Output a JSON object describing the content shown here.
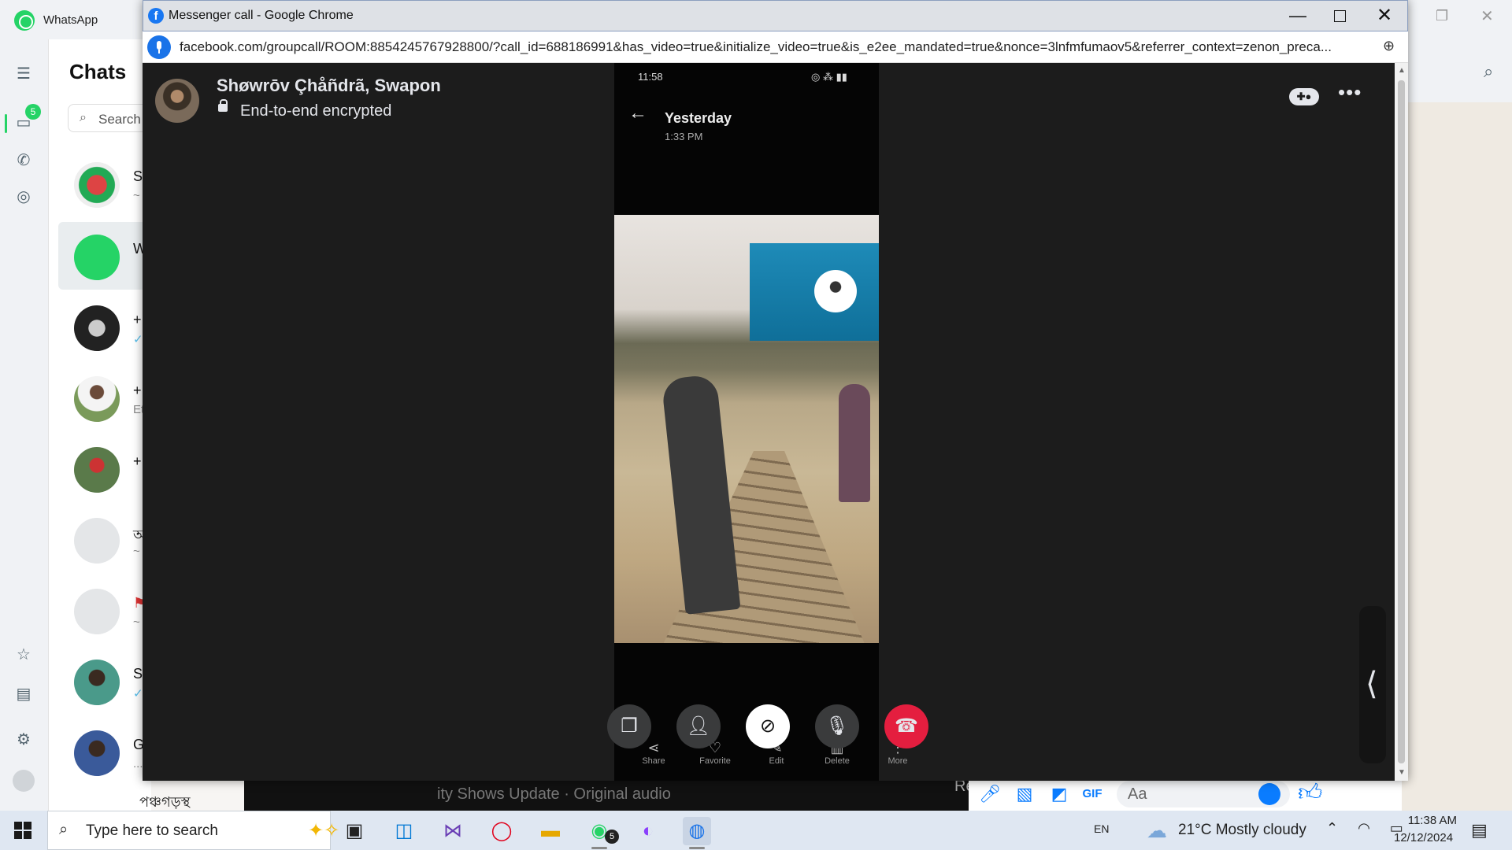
{
  "whatsapp": {
    "title": "WhatsApp",
    "badge": "5",
    "chats_title": "Chats",
    "search_placeholder": "Search",
    "chats": [
      {
        "name": "Sa",
        "sub": "~"
      },
      {
        "name": "W",
        "sub": ""
      },
      {
        "name": "+",
        "sub": "✓"
      },
      {
        "name": "+",
        "sub": "Et"
      },
      {
        "name": "+",
        "sub": ""
      },
      {
        "name": "অ",
        "sub": "~"
      },
      {
        "name": "",
        "sub": "~"
      },
      {
        "name": "Sl",
        "sub": "✓"
      },
      {
        "name": "G",
        "sub": "..."
      }
    ],
    "bottom_chat_text": "পঞ্চগড়স্থ তারিয়া"
  },
  "chrome": {
    "window_title": "Messenger call - Google Chrome",
    "url": "facebook.com/groupcall/ROOM:8854245767928800/?call_id=688186991&has_video=true&initialize_video=true&is_e2ee_mandated=true&nonce=3lnfmfumaov5&referrer_context=zenon_preca..."
  },
  "call": {
    "caller_name": "Shøwrōv Çhåñdrã, Swapon",
    "encryption_label": "End-to-end encrypted",
    "screen": {
      "status_time": "11:58",
      "date_label": "Yesterday",
      "time_label": "1:33 PM",
      "actions": [
        "Share",
        "Favorite",
        "Edit",
        "Delete",
        "More"
      ]
    }
  },
  "behind_bar": {
    "reel_text": "ity Shows Update · Original audio",
    "reel_text2": "Re",
    "composer_placeholder": "Aa",
    "composer_gif": "GIF"
  },
  "taskbar": {
    "search_placeholder": "Type here to search",
    "whatsapp_badge": "5",
    "language": "EN",
    "weather": "21°C  Mostly cloudy",
    "time": "11:38 AM",
    "date": "12/12/2024"
  },
  "colors": {
    "whatsapp_green": "#25d366",
    "messenger_blue": "#0a7cff",
    "end_call_red": "#e41e3f"
  }
}
